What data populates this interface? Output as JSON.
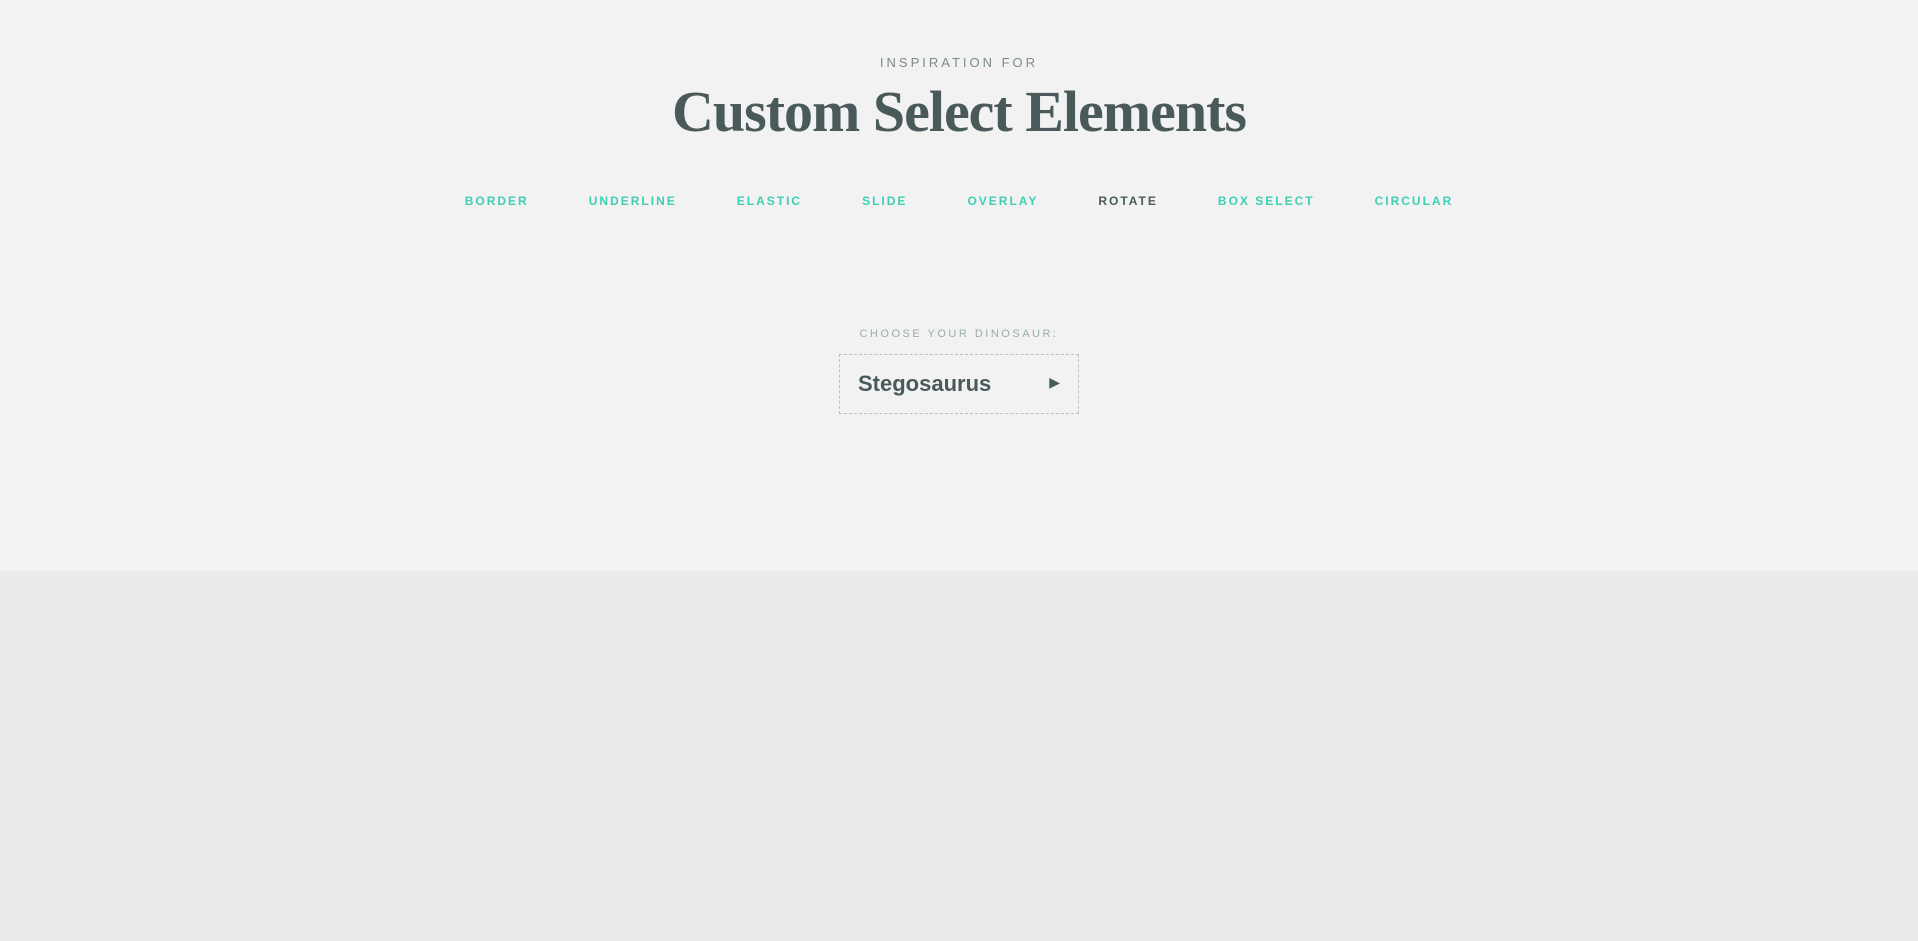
{
  "header": {
    "subtitle": "INSPIRATION FOR",
    "main_title": "Custom Select Elements"
  },
  "nav": {
    "items": [
      {
        "label": "BORDER",
        "style": "teal"
      },
      {
        "label": "UNDERLINE",
        "style": "teal"
      },
      {
        "label": "ELASTIC",
        "style": "teal"
      },
      {
        "label": "SLIDE",
        "style": "teal"
      },
      {
        "label": "OVERLAY",
        "style": "teal"
      },
      {
        "label": "ROTATE",
        "style": "dark"
      },
      {
        "label": "BOX SELECT",
        "style": "teal"
      },
      {
        "label": "CIRCULAR",
        "style": "teal"
      }
    ]
  },
  "content": {
    "choose_label": "CHOOSE YOUR DINOSAUR:",
    "select_value": "Stegosaurus",
    "select_arrow": "▶"
  }
}
